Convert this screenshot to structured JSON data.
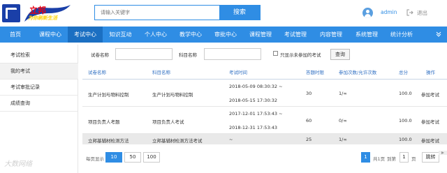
{
  "header": {
    "logo_title": "立邦",
    "logo_slogan": "为你刷新生活",
    "search_placeholder": "请输入关键字",
    "search_button": "搜索",
    "username": "admin",
    "logout": "退出"
  },
  "nav": {
    "items": [
      "首页",
      "课程中心",
      "考试中心",
      "知识互动",
      "个人中心",
      "教学中心",
      "审批中心",
      "课程管理",
      "考试管理",
      "内容管理",
      "系统管理",
      "统计分析"
    ],
    "active_index": 2
  },
  "sidebar": {
    "items": [
      "考试检索",
      "我的考试",
      "考试审批记录",
      "成绩查询"
    ],
    "active_index": 1
  },
  "filters": {
    "exam_name_label": "试卷名称",
    "subject_name_label": "科目名称",
    "only_unjoined_label": "只显示未参加的考试",
    "query_button": "查询"
  },
  "table": {
    "headers": [
      "试卷名称",
      "科目名称",
      "考试时间",
      "答题时限",
      "参加次数/允许次数",
      "总分",
      "操作"
    ],
    "rows": [
      {
        "exam": "生产计划与物料控制",
        "subject": "生产计划与物料控制",
        "time_start": "2018-05-09 08:30:32 ~",
        "time_end": "2018-05-15 17:30:32",
        "limit": "30",
        "attempts": "1/∞",
        "score": "100.0",
        "action": "参加考试"
      },
      {
        "exam": "项目负责人考题",
        "subject": "项目负责人考试",
        "time_start": "2017-12-01 17:53:43 ~",
        "time_end": "2018-12-31 17:53:43",
        "limit": "60",
        "attempts": "0/∞",
        "score": "100.0",
        "action": "参加考试"
      },
      {
        "exam": "立邦基辅材检测方法",
        "subject": "立邦基辅材检测方法考试",
        "time_start": "~",
        "time_end": "",
        "limit": "25",
        "attempts": "1/∞",
        "score": "100.0",
        "action": "参加考试"
      }
    ]
  },
  "pager": {
    "page_size_label": "每页显示",
    "page_sizes": [
      "10",
      "50",
      "100"
    ],
    "current_page": "1",
    "total_pages": "共1页",
    "goto_label": "到第",
    "goto_value": "1",
    "page_unit": "页",
    "goto_button": "跳转"
  },
  "watermark": "大数网络",
  "colors": {
    "primary": "#2f8de4",
    "nav_active": "#1b6fc2",
    "logo_red": "#e60012",
    "logo_blue": "#1a3fa8"
  }
}
